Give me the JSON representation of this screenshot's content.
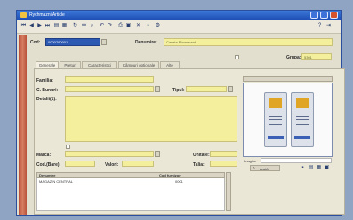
{
  "window": {
    "title": "Rychmazni Article"
  },
  "header": {
    "code_label": "Cod:",
    "code_value": "0000790001",
    "name_label": "Denumire:",
    "name_value": "Caseta Phonecard"
  },
  "options": {
    "group_label": "Grupa:",
    "group_value": "5301"
  },
  "tabs": [
    "Generale",
    "Prețuri",
    "Caracteristici",
    "Câmpuri opționale",
    "Alte"
  ],
  "form": {
    "family_label": "Familia:",
    "family_value": "",
    "category_label": "C. Bunuri:",
    "category_value": "",
    "type_label": "Tipul:",
    "type_value": "",
    "description_label": "Detalii(1):",
    "brand_label": "Marca:",
    "brand_value": "",
    "um_label": "Unitate:",
    "um_value": "",
    "cod_label": "Cod.(Bare):",
    "cod_value": "",
    "value_label": "Valori:",
    "value_value": "",
    "size_label": "Talia:",
    "size_value": ""
  },
  "photo": {
    "caption": "Imagine",
    "button_label": "Arată"
  },
  "table": {
    "headers": [
      "Denumire",
      "Cod furnizor"
    ],
    "rows": [
      [
        "MAGAZIN CENTRAL",
        "0001"
      ]
    ]
  },
  "colors": {
    "accent": "#2d59b3",
    "field": "#f3ef9d",
    "titlebar": "#1f4fb5"
  }
}
